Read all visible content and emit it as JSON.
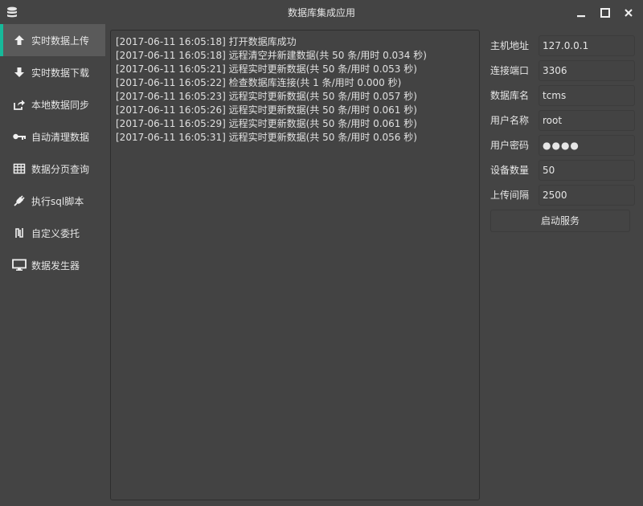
{
  "window": {
    "title": "数据库集成应用"
  },
  "sidebar": {
    "accent_color": "#17b99a",
    "items": [
      {
        "label": "实时数据上传",
        "icon": "arrow-up-icon",
        "active": true
      },
      {
        "label": "实时数据下载",
        "icon": "arrow-down-icon",
        "active": false
      },
      {
        "label": "本地数据同步",
        "icon": "share-icon",
        "active": false
      },
      {
        "label": "自动清理数据",
        "icon": "key-icon",
        "active": false
      },
      {
        "label": "数据分页查询",
        "icon": "table-icon",
        "active": false
      },
      {
        "label": "执行sql脚本",
        "icon": "plug-icon",
        "active": false
      },
      {
        "label": "自定义委托",
        "icon": "currency-icon",
        "active": false
      },
      {
        "label": "数据发生器",
        "icon": "monitor-icon",
        "active": false
      }
    ]
  },
  "log": {
    "lines": [
      "[2017-06-11 16:05:18] 打开数据库成功",
      "[2017-06-11 16:05:18] 远程清空并新建数据(共 50 条/用时 0.034 秒)",
      "[2017-06-11 16:05:21] 远程实时更新数据(共 50 条/用时 0.053 秒)",
      "[2017-06-11 16:05:22] 检查数据库连接(共 1 条/用时 0.000 秒)",
      "[2017-06-11 16:05:23] 远程实时更新数据(共 50 条/用时 0.057 秒)",
      "[2017-06-11 16:05:26] 远程实时更新数据(共 50 条/用时 0.061 秒)",
      "[2017-06-11 16:05:29] 远程实时更新数据(共 50 条/用时 0.061 秒)",
      "[2017-06-11 16:05:31] 远程实时更新数据(共 50 条/用时 0.056 秒)"
    ]
  },
  "form": {
    "host": {
      "label": "主机地址",
      "value": "127.0.0.1"
    },
    "port": {
      "label": "连接端口",
      "value": "3306"
    },
    "dbname": {
      "label": "数据库名",
      "value": "tcms"
    },
    "user": {
      "label": "用户名称",
      "value": "root"
    },
    "password": {
      "label": "用户密码",
      "value": "●●●●"
    },
    "count": {
      "label": "设备数量",
      "value": "50"
    },
    "interval": {
      "label": "上传间隔",
      "value": "2500"
    },
    "start_label": "启动服务"
  }
}
